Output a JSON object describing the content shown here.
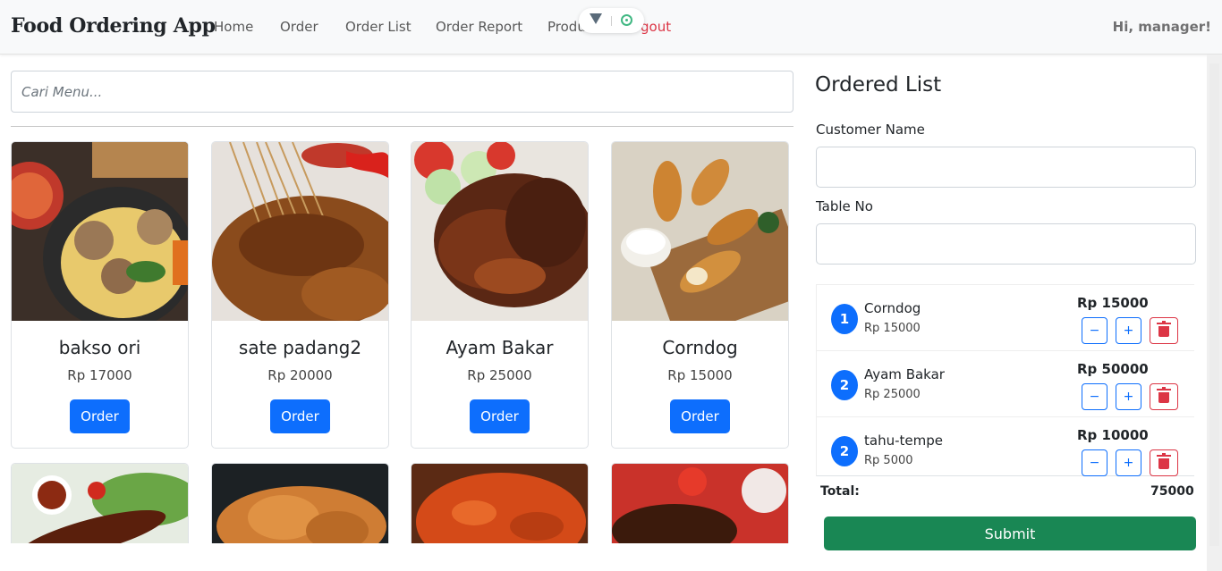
{
  "app": {
    "brand": "Food Ordering App",
    "greeting": "Hi, manager!"
  },
  "nav": {
    "items": [
      {
        "label": "Home"
      },
      {
        "label": "Order"
      },
      {
        "label": "Order List"
      },
      {
        "label": "Order Report"
      },
      {
        "label": "Produ"
      }
    ],
    "logout_label": "gout"
  },
  "search": {
    "placeholder": "Cari Menu..."
  },
  "products": [
    {
      "name": "bakso ori",
      "price": "Rp 17000",
      "button": "Order"
    },
    {
      "name": "sate padang2",
      "price": "Rp 20000",
      "button": "Order"
    },
    {
      "name": "Ayam Bakar",
      "price": "Rp 25000",
      "button": "Order"
    },
    {
      "name": "Corndog",
      "price": "Rp 15000",
      "button": "Order"
    }
  ],
  "ordered": {
    "title": "Ordered List",
    "customer_label": "Customer Name",
    "table_label": "Table No",
    "items": [
      {
        "qty": "1",
        "name": "Corndog",
        "unit": "Rp 15000",
        "total": "Rp 15000",
        "minus": "−",
        "plus": "+"
      },
      {
        "qty": "2",
        "name": "Ayam Bakar",
        "unit": "Rp 25000",
        "total": "Rp 50000",
        "minus": "−",
        "plus": "+"
      },
      {
        "qty": "2",
        "name": "tahu-tempe",
        "unit": "Rp 5000",
        "total": "Rp 10000",
        "minus": "−",
        "plus": "+"
      }
    ],
    "total_label": "Total:",
    "total_value": "75000",
    "submit_label": "Submit"
  },
  "icons": {
    "brand_devtools": "vue-devtools-icon",
    "inspect": "target-icon",
    "delete": "trash-icon"
  },
  "colors": {
    "primary": "#0d6efd",
    "success": "#198754",
    "danger": "#dc3545"
  }
}
